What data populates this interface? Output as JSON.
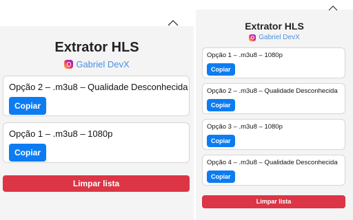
{
  "left_popup": {
    "title": "Extrator HLS",
    "author": "Gabriel DevX",
    "items": [
      {
        "label": "Opção 2 – .m3u8 – Qualidade Desconhecida",
        "copy_label": "Copiar"
      },
      {
        "label": "Opção 1 – .m3u8 – 1080p",
        "copy_label": "Copiar"
      }
    ],
    "clear_label": "Limpar lista"
  },
  "right_popup": {
    "title": "Extrator HLS",
    "author": "Gabriel DevX",
    "items": [
      {
        "label": "Opção 1 – .m3u8 – 1080p",
        "copy_label": "Copiar"
      },
      {
        "label": "Opção 2 – .m3u8 – Qualidade Desconhecida",
        "copy_label": "Copiar"
      },
      {
        "label": "Opção 3 – .m3u8 – 1080p",
        "copy_label": "Copiar"
      },
      {
        "label": "Opção 4 – .m3u8 – Qualidade Desconhecida",
        "copy_label": "Copiar"
      }
    ],
    "clear_label": "Limpar lista"
  },
  "colors": {
    "accent_blue": "#0d7cf2",
    "danger_red": "#dc3545",
    "author_link": "#4a90e2",
    "panel_bg": "#f4f4f4"
  },
  "icons": {
    "collapse": "chevron-up-icon",
    "author": "instagram-icon"
  }
}
